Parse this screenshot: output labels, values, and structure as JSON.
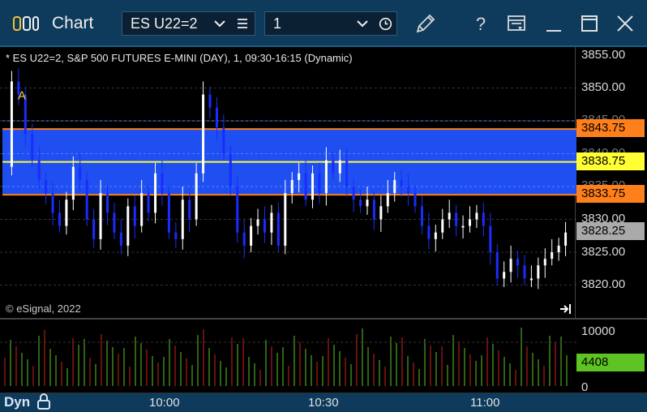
{
  "window": {
    "title": "Chart",
    "symbol": "ES U22=2",
    "interval": "1"
  },
  "icons": {
    "app": "chart-app-icon",
    "symbol_dropdown": "chevron-down-icon",
    "symbol_menu": "hamburger-menu-icon",
    "interval_dropdown": "chevron-down-icon",
    "interval_clock": "clock-icon",
    "draw": "pencil-icon",
    "help": "question-mark-icon",
    "template": "template-icon",
    "minimize": "minimize-icon",
    "maximize": "maximize-icon",
    "close": "close-icon",
    "lock": "lock-icon",
    "scroll_end": "scroll-to-end-icon"
  },
  "chart": {
    "header": "* ES U22=2, S&P 500 FUTURES E-MINI (DAY), 1, 09:30-16:15 (Dynamic)",
    "copyright": "© eSignal, 2022",
    "marker_label": "A",
    "price_ticks": [
      "3855.00",
      "3850.00",
      "3845.00",
      "3840.00",
      "3835.00",
      "3830.00",
      "3825.00",
      "3820.00"
    ],
    "band_upper": "3843.75",
    "band_mid": "3838.75",
    "band_lower": "3833.75",
    "last_price": "3828.25",
    "colors": {
      "band_fill": "#1f4ff0",
      "band_edge": "#ff7f1a",
      "band_mid": "#ffff33",
      "candle_up": "#ffffff",
      "candle_down": "#1a2cff",
      "volume_up": "#5ec423",
      "volume_down": "#d02020",
      "last_price_tag": "#aaaaaa",
      "volume_tag": "#5ec423"
    }
  },
  "volume": {
    "ticks": [
      "10000",
      "0"
    ],
    "last": "4408"
  },
  "footer": {
    "mode": "Dyn",
    "time_labels": [
      "10:00",
      "10:30",
      "11:00"
    ]
  }
}
